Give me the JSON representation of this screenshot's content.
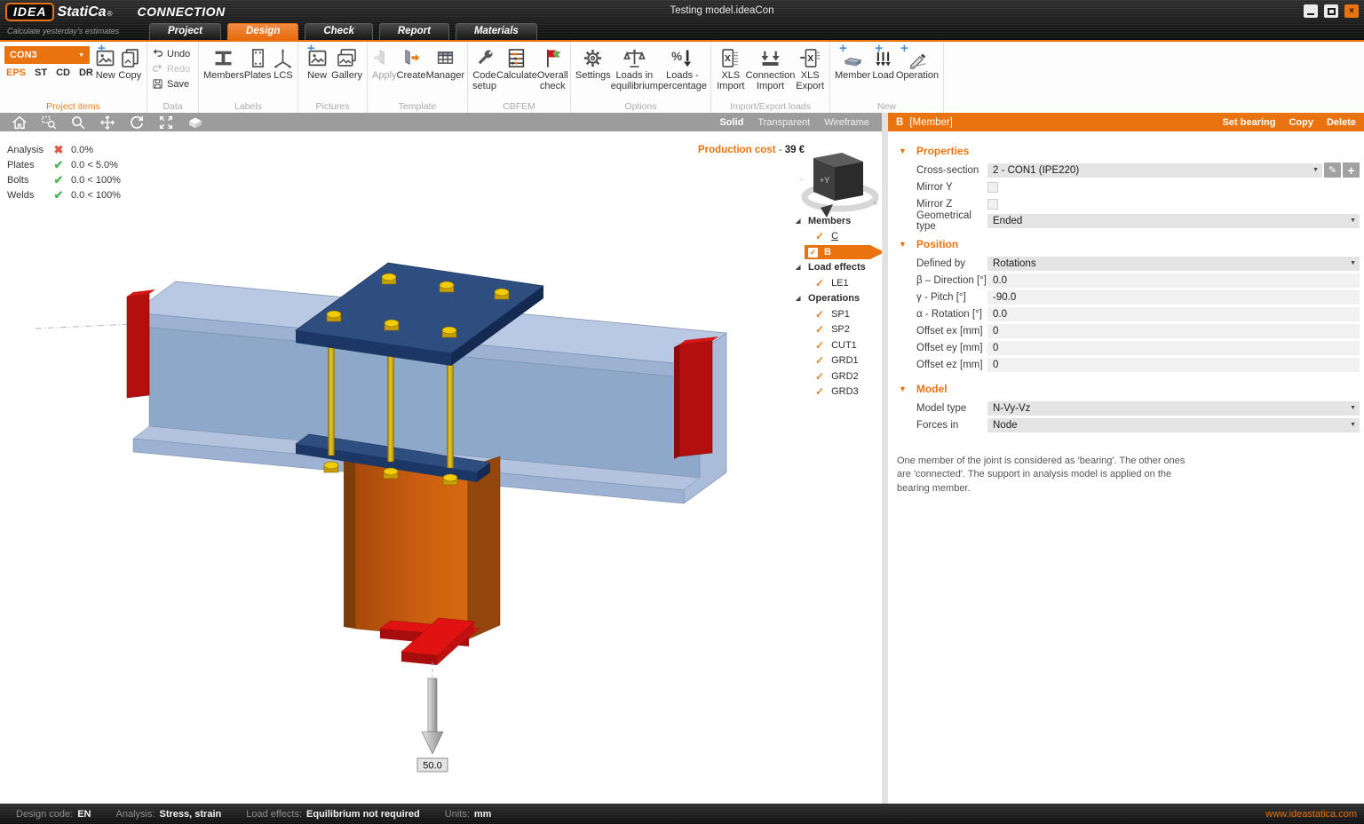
{
  "window": {
    "brand_idea": "IDEA",
    "brand_statica": "StatiCa",
    "brand_reg": "®",
    "brand_app": "CONNECTION",
    "tagline": "Calculate yesterday's estimates",
    "title": "Testing model.ideaCon"
  },
  "tabs": [
    {
      "label": "Project"
    },
    {
      "label": "Design"
    },
    {
      "label": "Check"
    },
    {
      "label": "Report"
    },
    {
      "label": "Materials"
    }
  ],
  "ribbon": {
    "project_items": {
      "group": "Project items",
      "selector": "CON3",
      "modes": [
        "EPS",
        "ST",
        "CD",
        "DR"
      ],
      "new_label": "New",
      "copy_label": "Copy"
    },
    "data": {
      "group": "Data",
      "undo": "Undo",
      "redo": "Redo",
      "save": "Save"
    },
    "labels": {
      "group": "Labels",
      "members": "Members",
      "plates": "Plates",
      "lcs": "LCS"
    },
    "pictures": {
      "group": "Pictures",
      "new": "New",
      "gallery": "Gallery"
    },
    "template": {
      "group": "Template",
      "apply": "Apply",
      "create": "Create",
      "manager": "Manager"
    },
    "cbfem": {
      "group": "CBFEM",
      "code_setup": "Code setup",
      "calculate": "Calculate",
      "overall_check": "Overall check"
    },
    "options": {
      "group": "Options",
      "settings": "Settings",
      "loads_eq": "Loads in equilibrium",
      "loads_pct": "Loads - percentage"
    },
    "import_export": {
      "group": "Import/Export loads",
      "xls_import": "XLS Import",
      "conn_import": "Connection Import",
      "xls_export": "XLS Export"
    },
    "new": {
      "group": "New",
      "member": "Member",
      "load": "Load",
      "operation": "Operation"
    }
  },
  "viewport": {
    "toolbar": {
      "render_modes": [
        "Solid",
        "Transparent",
        "Wireframe"
      ],
      "active_mode": "Solid"
    },
    "analysis": [
      {
        "label": "Analysis",
        "status": "fail",
        "value": "0.0%"
      },
      {
        "label": "Plates",
        "status": "pass",
        "value": "0.0 < 5.0%"
      },
      {
        "label": "Bolts",
        "status": "pass",
        "value": "0.0 < 100%"
      },
      {
        "label": "Welds",
        "status": "pass",
        "value": "0.0 < 100%"
      }
    ],
    "production_cost": {
      "label": "Production cost",
      "separator": "-",
      "value": "39 €"
    },
    "nav_cube_label": "+Y",
    "load_label": "50.0",
    "tree": {
      "sections": [
        {
          "label": "Members",
          "items": [
            {
              "label": "C",
              "checked": true
            },
            {
              "label": "B",
              "checked": true,
              "selected": true
            }
          ]
        },
        {
          "label": "Load effects",
          "items": [
            {
              "label": "LE1",
              "checked": true
            }
          ]
        },
        {
          "label": "Operations",
          "items": [
            {
              "label": "SP1",
              "checked": true
            },
            {
              "label": "SP2",
              "checked": true
            },
            {
              "label": "CUT1",
              "checked": true
            },
            {
              "label": "GRD1",
              "checked": true
            },
            {
              "label": "GRD2",
              "checked": true
            },
            {
              "label": "GRD3",
              "checked": true
            }
          ]
        }
      ]
    }
  },
  "panel": {
    "header": {
      "id": "B",
      "type": "[Member]",
      "actions": [
        "Set bearing",
        "Copy",
        "Delete"
      ]
    },
    "properties": {
      "title": "Properties",
      "cross_section_label": "Cross-section",
      "cross_section_value": "2 - CON1 (IPE220)",
      "mirror_y_label": "Mirror Y",
      "mirror_z_label": "Mirror Z",
      "geom_type_label": "Geometrical type",
      "geom_type_value": "Ended"
    },
    "position": {
      "title": "Position",
      "defined_by_label": "Defined by",
      "defined_by_value": "Rotations",
      "beta_label": "β – Direction [°]",
      "beta_value": "0.0",
      "gamma_label": "γ - Pitch [°]",
      "gamma_value": "-90.0",
      "alpha_label": "α - Rotation [°]",
      "alpha_value": "0.0",
      "ex_label": "Offset ex [mm]",
      "ex_value": "0",
      "ey_label": "Offset ey [mm]",
      "ey_value": "0",
      "ez_label": "Offset ez [mm]",
      "ez_value": "0"
    },
    "model": {
      "title": "Model",
      "type_label": "Model type",
      "type_value": "N-Vy-Vz",
      "forces_label": "Forces in",
      "forces_value": "Node"
    },
    "help_text": "One member of the joint is considered as 'bearing'. The other ones are 'connected'. The support in analysis model is applied on the bearing member."
  },
  "statusbar": {
    "items": [
      {
        "label": "Design code:",
        "value": "EN"
      },
      {
        "label": "Analysis:",
        "value": "Stress, strain"
      },
      {
        "label": "Load effects:",
        "value": "Equilibrium not required"
      },
      {
        "label": "Units:",
        "value": "mm"
      }
    ],
    "website": "www.ideastatica.com"
  },
  "colors": {
    "accent": "#E8730F",
    "status_pass": "#53B45A",
    "status_fail": "#E2574C",
    "selection": "#E8730F"
  }
}
